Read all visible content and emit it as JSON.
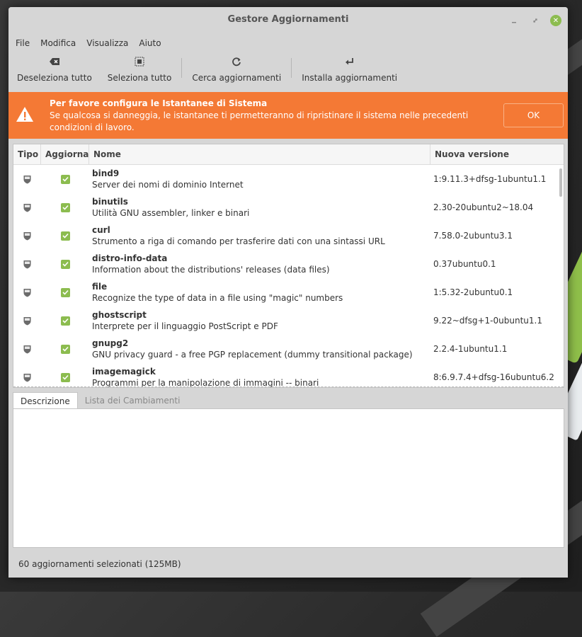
{
  "window": {
    "title": "Gestore Aggiornamenti"
  },
  "menu": [
    "File",
    "Modifica",
    "Visualizza",
    "Aiuto"
  ],
  "toolbar": {
    "deselect_label": "Deseleziona tutto",
    "select_label": "Seleziona tutto",
    "refresh_label": "Cerca aggiornamenti",
    "install_label": "Installa aggiornamenti"
  },
  "infobar": {
    "heading": "Per favore configura le Istantanee di Sistema",
    "message": "Se qualcosa si danneggia, le istantanee ti permetteranno di ripristinare il sistema nelle precedenti condizioni di lavoro.",
    "ok_label": "OK",
    "color": "#f47935"
  },
  "columns": {
    "tipo": "Tipo",
    "aggiorna": "Aggiorna",
    "nome": "Nome",
    "versione": "Nuova versione"
  },
  "packages": [
    {
      "name": "bind9",
      "desc": "Server dei nomi di dominio Internet",
      "version": "1:9.11.3+dfsg-1ubuntu1.1",
      "checked": true
    },
    {
      "name": "binutils",
      "desc": "Utilità GNU assembler, linker e binari",
      "version": "2.30-20ubuntu2~18.04",
      "checked": true
    },
    {
      "name": "curl",
      "desc": "Strumento a riga di comando per trasferire dati con una sintassi URL",
      "version": "7.58.0-2ubuntu3.1",
      "checked": true
    },
    {
      "name": "distro-info-data",
      "desc": "Information about the distributions' releases (data files)",
      "version": "0.37ubuntu0.1",
      "checked": true
    },
    {
      "name": "file",
      "desc": "Recognize the type of data in a file using \"magic\" numbers",
      "version": "1:5.32-2ubuntu0.1",
      "checked": true
    },
    {
      "name": "ghostscript",
      "desc": "Interprete per il linguaggio PostScript e PDF",
      "version": "9.22~dfsg+1-0ubuntu1.1",
      "checked": true
    },
    {
      "name": "gnupg2",
      "desc": "GNU privacy guard - a free PGP replacement (dummy transitional package)",
      "version": "2.2.4-1ubuntu1.1",
      "checked": true
    },
    {
      "name": "imagemagick",
      "desc": "Programmi per la manipolazione di immagini -- binari",
      "version": "8:6.9.7.4+dfsg-16ubuntu6.2",
      "checked": true
    }
  ],
  "tabs": {
    "description": "Descrizione",
    "changelog": "Lista dei Cambiamenti"
  },
  "status": "60 aggiornamenti selezionati (125MB)",
  "accent": "#8cbc4f"
}
